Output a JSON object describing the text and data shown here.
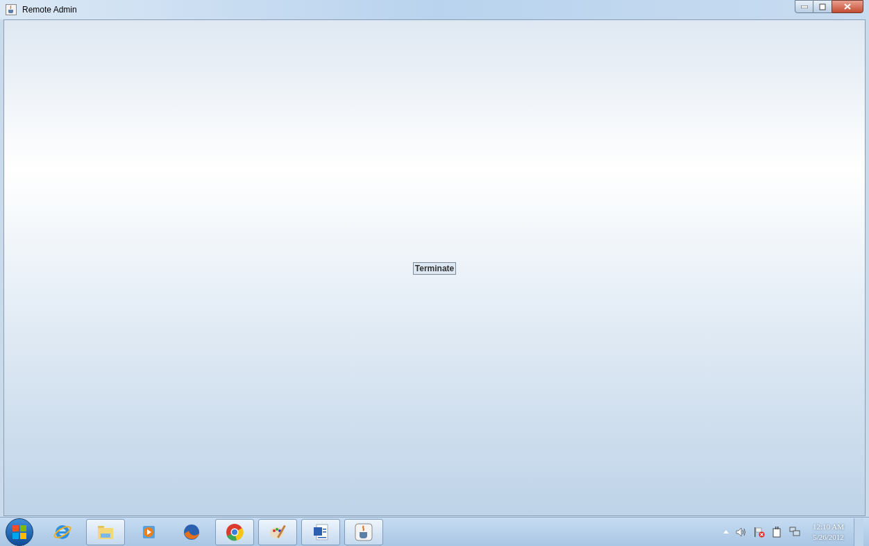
{
  "window": {
    "title": "Remote Admin"
  },
  "content": {
    "button": "Terminate"
  },
  "taskbar": {
    "apps": [
      {
        "kind": "browser-e",
        "running": false
      },
      {
        "kind": "folder",
        "running": true
      },
      {
        "kind": "player",
        "running": false
      },
      {
        "kind": "fox",
        "running": false
      },
      {
        "kind": "chrome",
        "running": true
      },
      {
        "kind": "paint",
        "running": true
      },
      {
        "kind": "word",
        "running": true
      },
      {
        "kind": "java",
        "running": true
      }
    ],
    "tray": {
      "time": "12:10 AM",
      "date": "5/26/2012"
    }
  }
}
